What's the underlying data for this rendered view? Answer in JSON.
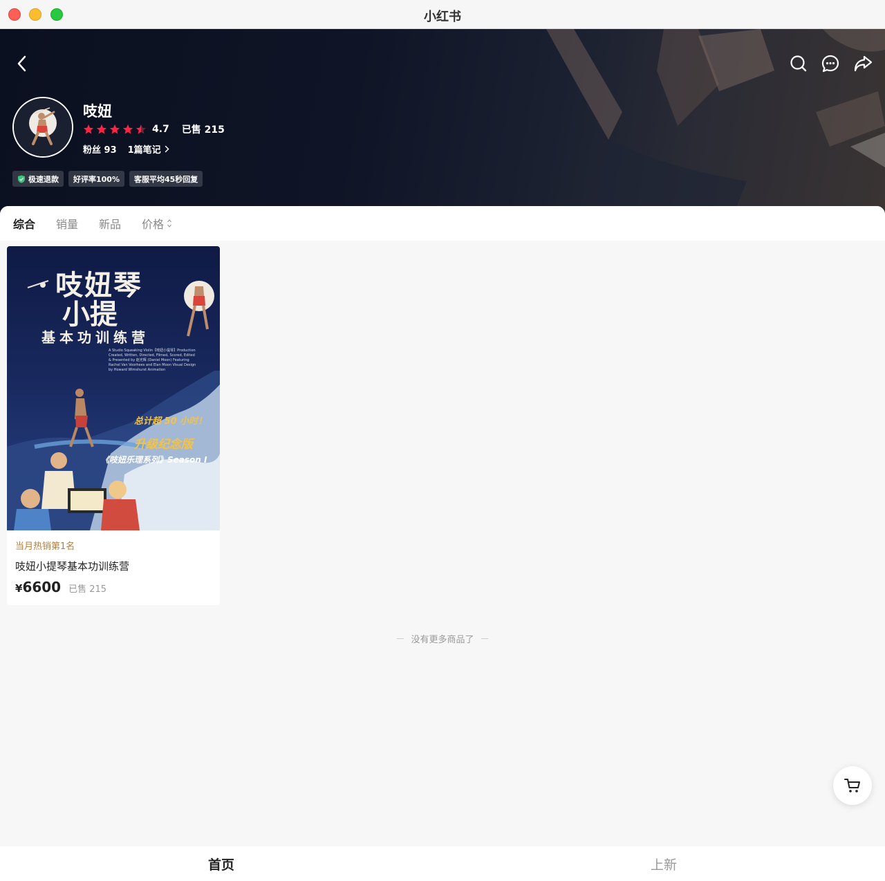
{
  "window": {
    "title": "小红书"
  },
  "shop": {
    "name": "吱妞",
    "rating": "4.7",
    "stars": 4.5,
    "sold": "已售 215",
    "fans": "粉丝 93",
    "notes": "1篇笔记",
    "badges": [
      "极速退款",
      "好评率100%",
      "客服平均45秒回复"
    ]
  },
  "sort": {
    "tabs": [
      "综合",
      "销量",
      "新品",
      "价格"
    ],
    "active": "综合"
  },
  "product": {
    "rank": "当月热销第1名",
    "title": "吱妞小提琴基本功训练营",
    "currency": "¥",
    "price": "6600",
    "sold": "已售 215",
    "poster": {
      "title_line1": "吱妞琴",
      "title_line2": "小提",
      "subtitle": "基本功训练营",
      "credits": "A Studio Squeaking Violin【吱妞小提琴】Production Created, Written, Directed, Filmed, Scored, Edited & Presented by 赵光辉 (Daniel Moon) Featuring Rachel Van Voorhees and Elan Moon Visual Design by Howard Wimshurst Animation",
      "highlight1": "总计超 50 小时！",
      "highlight2": "升级纪念版",
      "highlight3": "《吱妞乐理系列》Season I"
    }
  },
  "footer_text": "没有更多商品了",
  "bottom_nav": {
    "home": "首页",
    "new": "上新"
  },
  "colors": {
    "star": "#ff2442",
    "rank": "#b57e3a",
    "badge_check": "#3ac47a"
  }
}
